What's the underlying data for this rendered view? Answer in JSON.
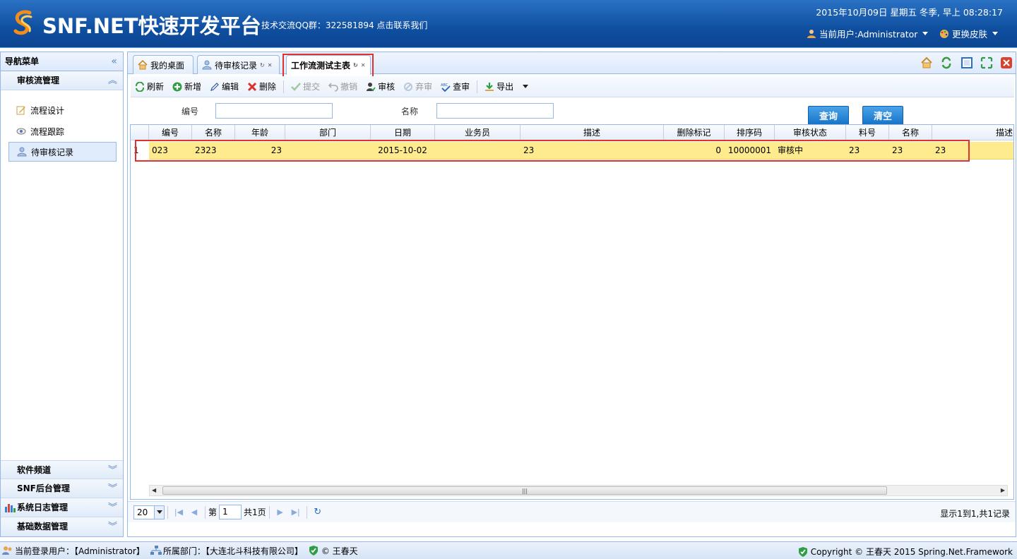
{
  "header": {
    "title": "SNF.NET快速开发平台",
    "qq_text": "技术交流QQ群：322581894 点击联系我们",
    "datetime": "2015年10月09日 星期五 冬季, 早上 08:28:17",
    "user_label": "当前用户:Administrator",
    "skin_label": "更换皮肤"
  },
  "nav": {
    "title": "导航菜单",
    "group_active": "审核流管理",
    "items": [
      {
        "label": "流程设计",
        "icon": "edit-note-icon"
      },
      {
        "label": "流程跟踪",
        "icon": "eye-icon"
      },
      {
        "label": "待审核记录",
        "icon": "user-icon"
      }
    ],
    "bottom_groups": [
      "软件频道",
      "SNF后台管理",
      "系统日志管理",
      "基础数据管理"
    ]
  },
  "tabs": [
    {
      "label": "我的桌面",
      "icon": "home-icon"
    },
    {
      "label": "待审核记录",
      "icon": "user-icon"
    },
    {
      "label": "工作流测试主表",
      "icon": ""
    }
  ],
  "toolbar": {
    "refresh": "刷新",
    "add": "新增",
    "edit": "编辑",
    "delete": "删除",
    "submit": "提交",
    "revoke": "撤销",
    "audit": "审核",
    "abandon": "弃审",
    "check": "查审",
    "export": "导出"
  },
  "search": {
    "code_label": "编号",
    "name_label": "名称",
    "query_btn": "查询",
    "clear_btn": "清空"
  },
  "grid": {
    "columns": [
      "编号",
      "名称",
      "年龄",
      "部门",
      "日期",
      "业务员",
      "描述",
      "删除标记",
      "排序码",
      "审核状态",
      "料号",
      "名称",
      "描述"
    ],
    "rows": [
      [
        "1",
        "023",
        "2323",
        "23",
        "",
        "2015-10-02",
        "",
        "23",
        "0",
        "10000001",
        "审核中",
        "23",
        "23",
        "23"
      ]
    ]
  },
  "pager": {
    "page_size": "20",
    "page_prefix": "第",
    "page_value": "1",
    "page_total": "共1页",
    "info": "显示1到1,共1记录"
  },
  "footer": {
    "login_user": "当前登录用户：【Administrator】",
    "department": "所属部门：【大连北斗科技有限公司】",
    "author": "© 王春天",
    "copyright": "Copyright © 王春天 2015 Spring.Net.Framework"
  },
  "colors": {
    "header_blue": "#0f4fa0",
    "highlight_red": "#e03030",
    "selected_row": "#fdeb8d"
  }
}
